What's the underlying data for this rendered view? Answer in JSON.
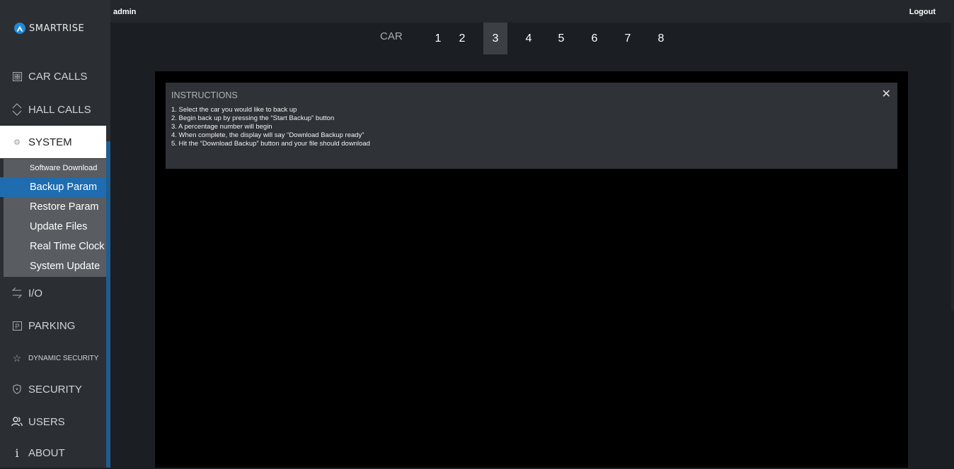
{
  "brand": {
    "name": "SMARTRISE",
    "logo_icon": "smartrise-logo-icon"
  },
  "topbar": {
    "user": "admin",
    "logout": "Logout"
  },
  "cars": {
    "label": "CAR",
    "tabs": [
      "1",
      "2",
      "3",
      "4",
      "5",
      "6",
      "7",
      "8"
    ],
    "selected": "3"
  },
  "sidebar": {
    "items": [
      {
        "label": "CAR CALLS",
        "icon": "elevator-panel-icon"
      },
      {
        "label": "HALL CALLS",
        "icon": "up-down-chevron-icon"
      },
      {
        "label": "SYSTEM",
        "icon": "gear-icon"
      },
      {
        "label": "I/O",
        "icon": "swap-arrows-icon"
      },
      {
        "label": "PARKING",
        "icon": "parking-icon"
      },
      {
        "label": "DYNAMIC SECURITY",
        "icon": "star-icon"
      },
      {
        "label": "SECURITY",
        "icon": "shield-icon"
      },
      {
        "label": "USERS",
        "icon": "users-icon"
      },
      {
        "label": "ABOUT",
        "icon": "info-icon"
      }
    ],
    "active": "SYSTEM",
    "system_submenu": [
      "Software Download",
      "Backup Param",
      "Restore Param",
      "Update Files",
      "Real Time Clock",
      "System Update"
    ],
    "active_submenu": "Backup Param"
  },
  "instructions": {
    "title": "INSTRUCTIONS",
    "steps": [
      "1. Select the car you would like to back up",
      "2. Begin back up by pressing the “Start Backup” button",
      "3. A percentage number will begin",
      "4. When complete, the display will say “Download Backup ready”",
      "5. Hit the “Download Backup” button and your file should download"
    ],
    "close_icon": "close-icon"
  },
  "colors": {
    "accent": "#1f6cb0",
    "logo": "#1f8ad8",
    "sidebar": "#2b2e33",
    "submenu": "#595c61"
  }
}
